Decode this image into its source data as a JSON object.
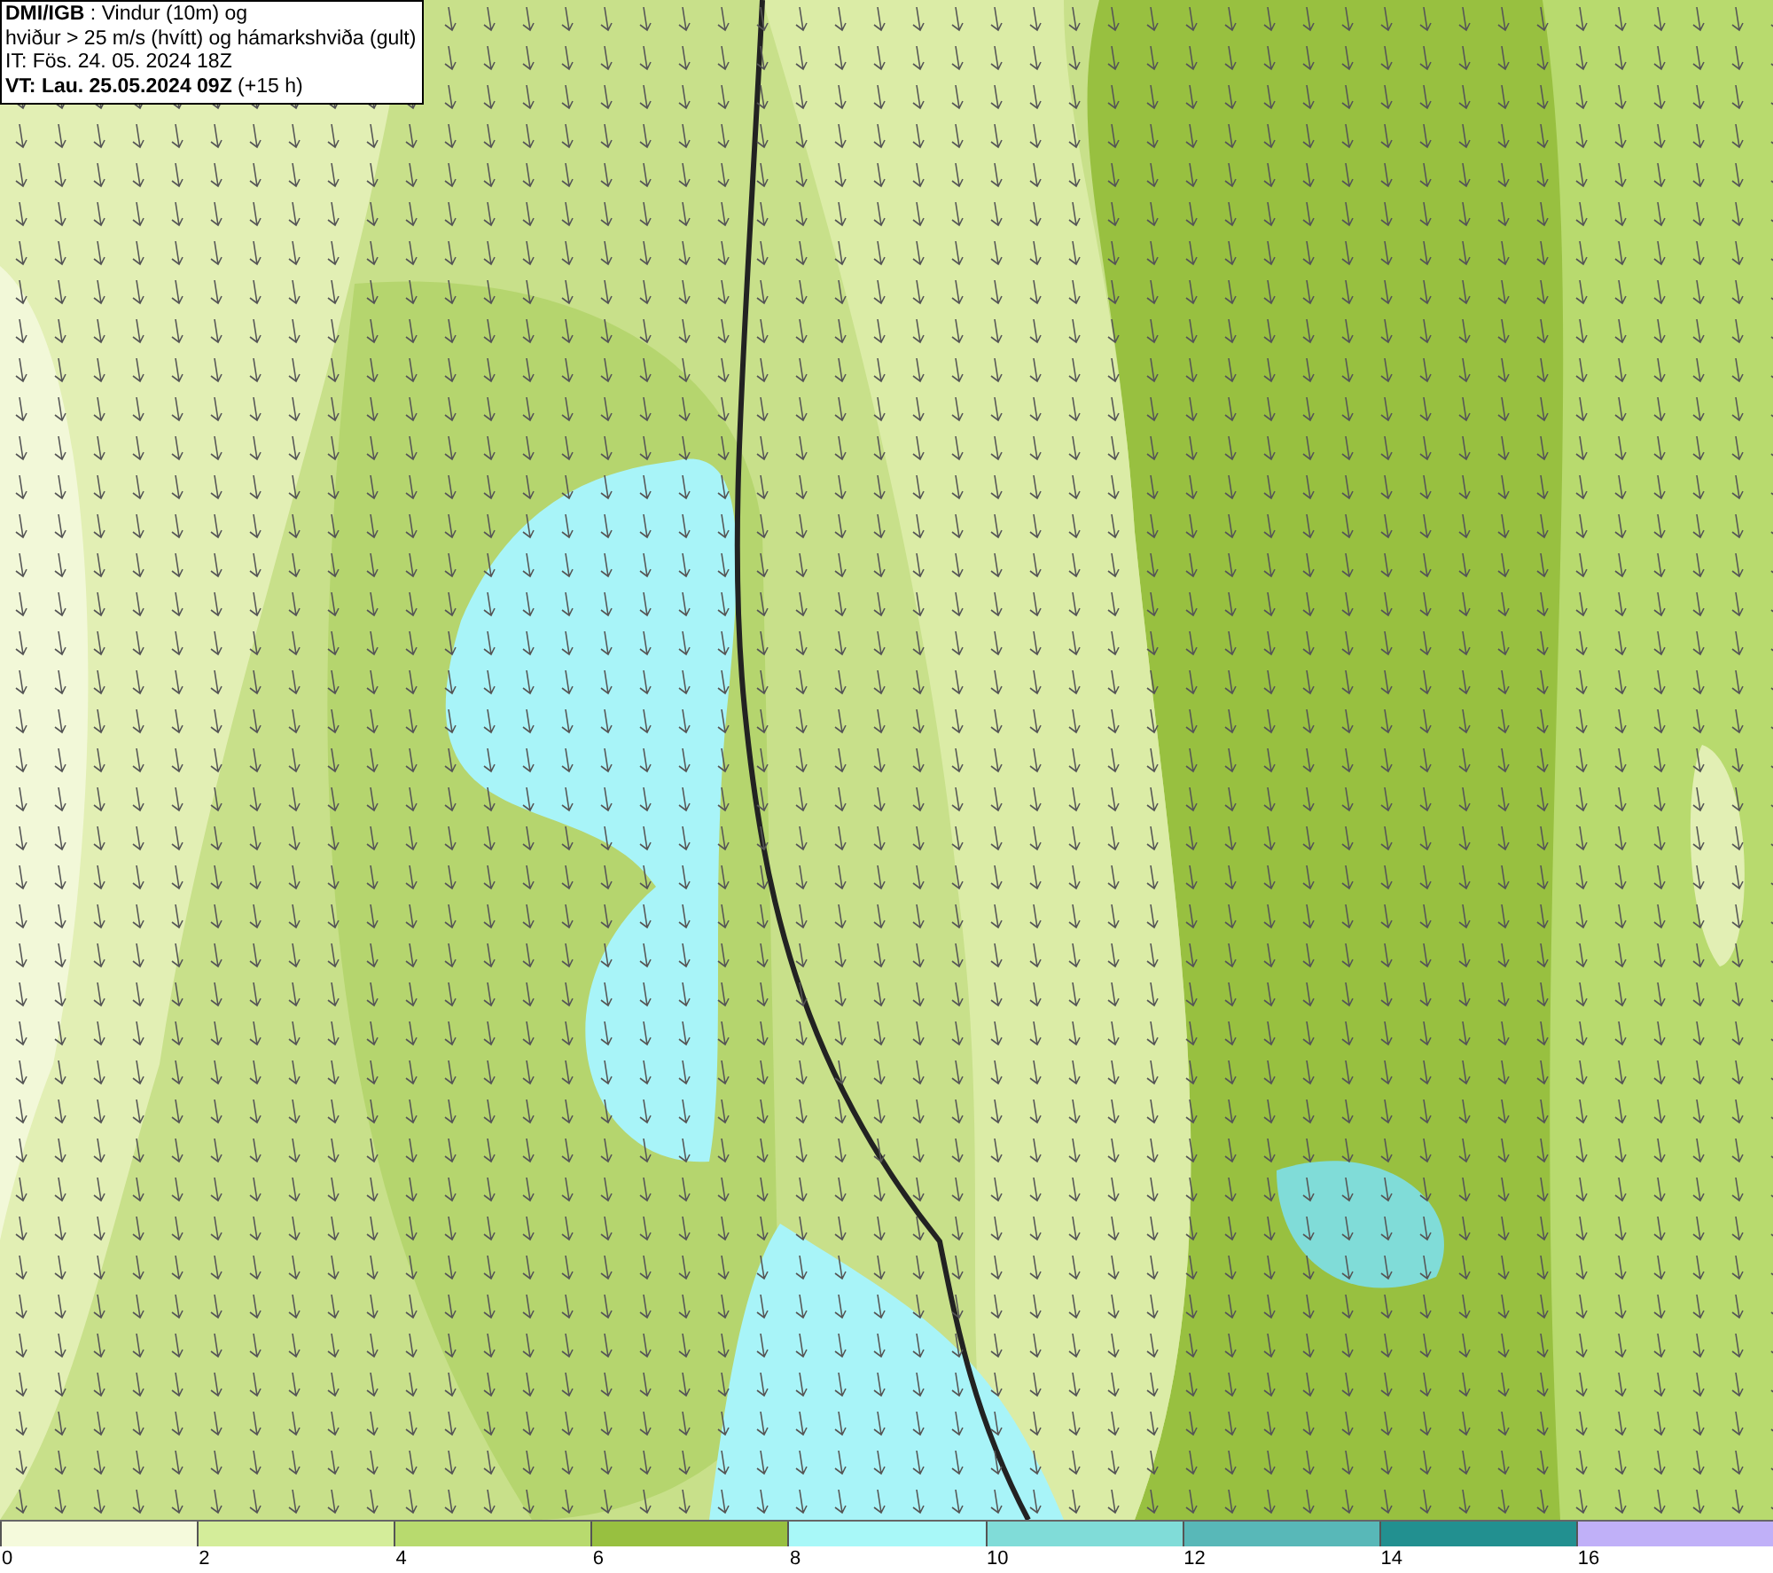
{
  "title_box": {
    "lines": [
      "**DMI/IGB** : Vindur (10m) og",
      "hviður > 25 m/s (hvítt) og hámarkshviða (gult)",
      "IT: Fös. 24. 05. 2024 18Z",
      "**VT: Lau. 25.05.2024 09Z** (+15 h)"
    ]
  },
  "legend": {
    "segments": [
      {
        "color": "#f5fadc",
        "label": "0"
      },
      {
        "color": "#d4ed9a",
        "label": "2"
      },
      {
        "color": "#b8da6e",
        "label": "4"
      },
      {
        "color": "#98c040",
        "label": "6"
      },
      {
        "color": "#a8f8f8",
        "label": "8"
      },
      {
        "color": "#80dcd8",
        "label": "10"
      },
      {
        "color": "#58b8b8",
        "label": "12"
      },
      {
        "color": "#229090",
        "label": "14"
      },
      {
        "color": "#c0b0f8",
        "label": "16"
      }
    ]
  }
}
